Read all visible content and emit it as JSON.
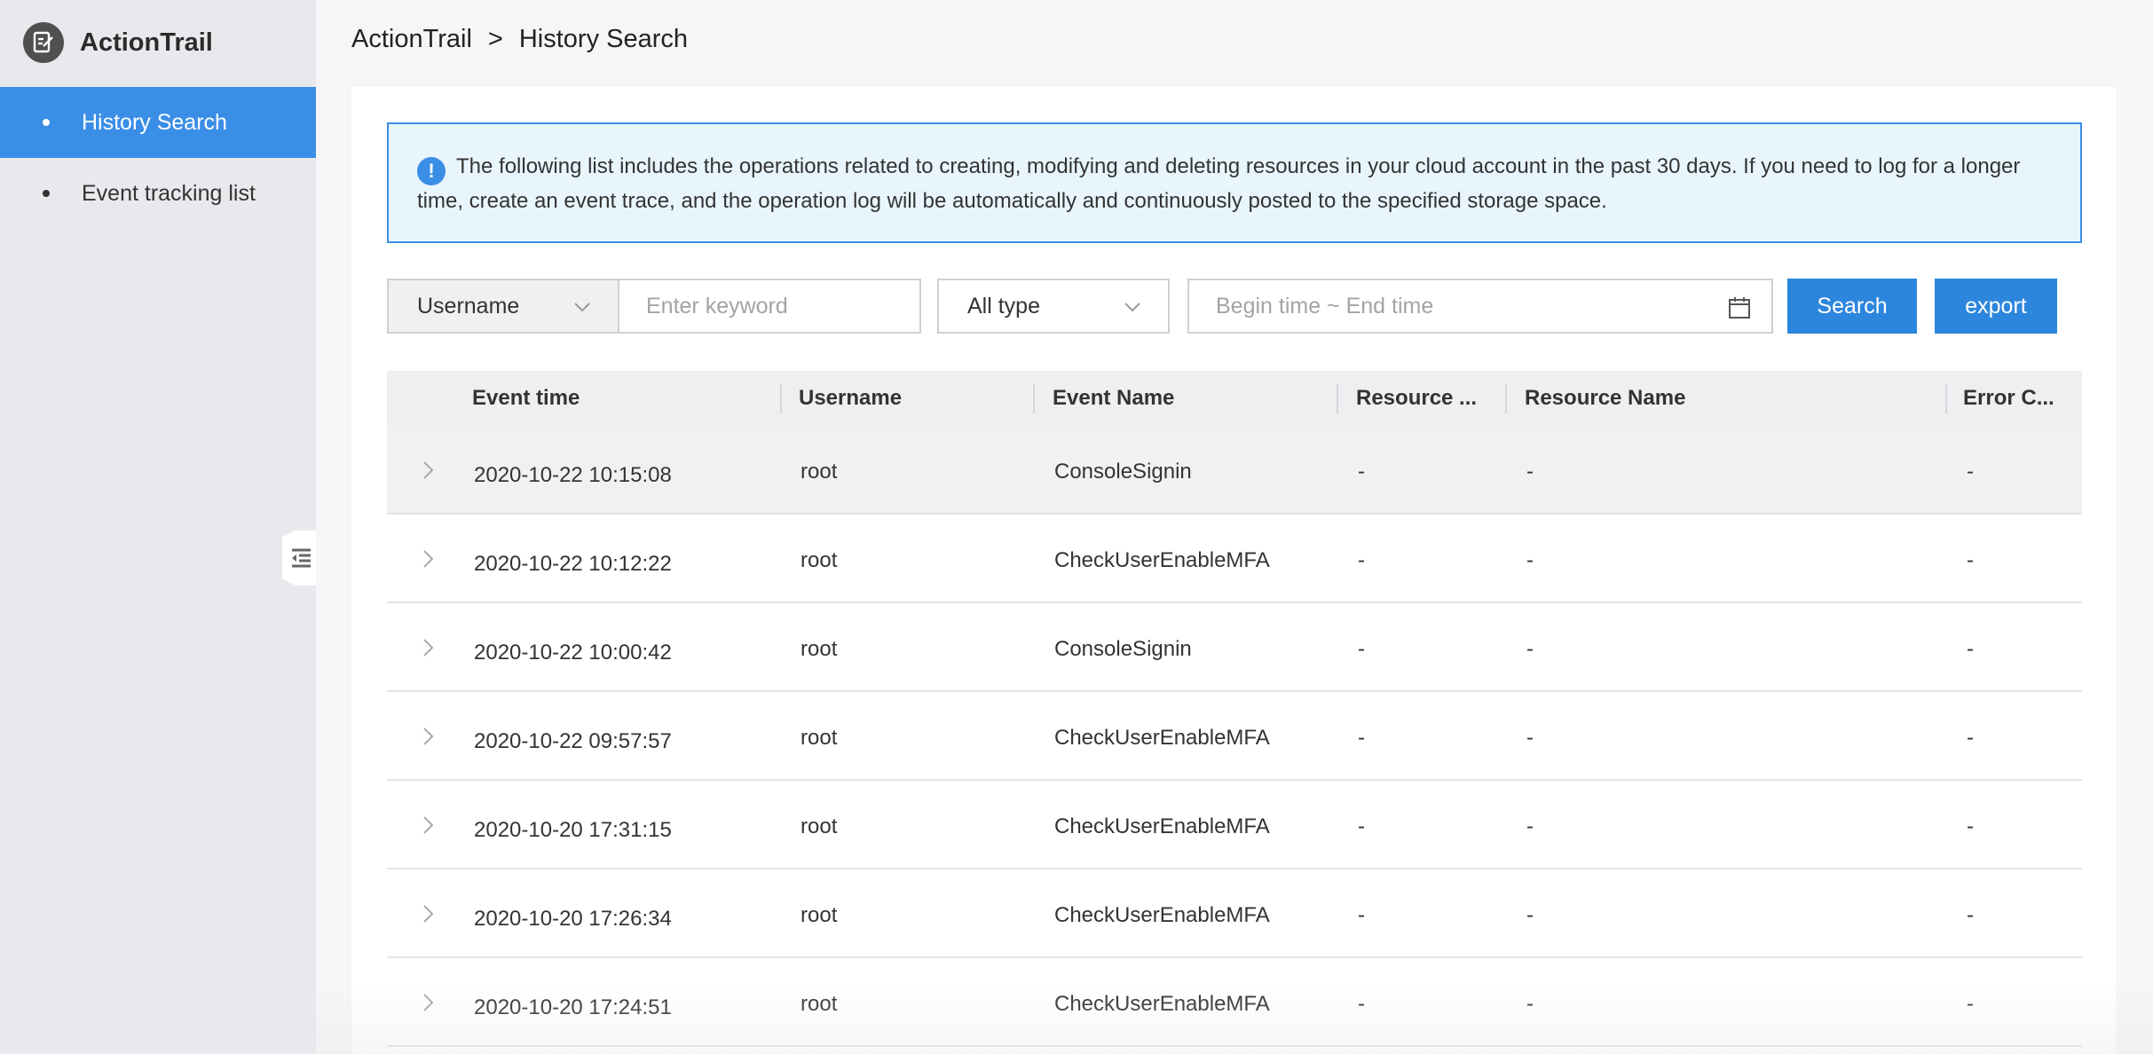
{
  "sidebar": {
    "title": "ActionTrail",
    "logo_icon": "audit-icon",
    "items": [
      {
        "label": "History Search",
        "active": true
      },
      {
        "label": "Event tracking list",
        "active": false
      }
    ]
  },
  "breadcrumb": {
    "root": "ActionTrail",
    "separator": ">",
    "current": "History Search"
  },
  "notice": {
    "icon": "!",
    "text": "The following list includes the operations related to creating, modifying and deleting resources in your cloud account in the past 30 days. If you need to log for a longer time, create an event trace, and the operation log will be automatically and continuously posted to the specified storage space."
  },
  "filters": {
    "field_select": "Username",
    "keyword_placeholder": "Enter keyword",
    "type_select": "All type",
    "time_placeholder": "Begin time ~ End time",
    "search_label": "Search",
    "export_label": "export"
  },
  "table": {
    "columns": [
      "Event time",
      "Username",
      "Event Name",
      "Resource ...",
      "Resource Name",
      "Error C..."
    ],
    "rows": [
      {
        "time": "2020-10-22 10:15:08",
        "user": "root",
        "event": "ConsoleSignin",
        "rtype": "-",
        "rname": "-",
        "error": "-"
      },
      {
        "time": "2020-10-22 10:12:22",
        "user": "root",
        "event": "CheckUserEnableMFA",
        "rtype": "-",
        "rname": "-",
        "error": "-"
      },
      {
        "time": "2020-10-22 10:00:42",
        "user": "root",
        "event": "ConsoleSignin",
        "rtype": "-",
        "rname": "-",
        "error": "-"
      },
      {
        "time": "2020-10-22 09:57:57",
        "user": "root",
        "event": "CheckUserEnableMFA",
        "rtype": "-",
        "rname": "-",
        "error": "-"
      },
      {
        "time": "2020-10-20 17:31:15",
        "user": "root",
        "event": "CheckUserEnableMFA",
        "rtype": "-",
        "rname": "-",
        "error": "-"
      },
      {
        "time": "2020-10-20 17:26:34",
        "user": "root",
        "event": "CheckUserEnableMFA",
        "rtype": "-",
        "rname": "-",
        "error": "-"
      },
      {
        "time": "2020-10-20 17:24:51",
        "user": "root",
        "event": "CheckUserEnableMFA",
        "rtype": "-",
        "rname": "-",
        "error": "-"
      }
    ]
  },
  "colors": {
    "accent": "#2d86dd",
    "sidebar_active": "#3a8ee6",
    "notice_bg": "#e8f5fd"
  }
}
